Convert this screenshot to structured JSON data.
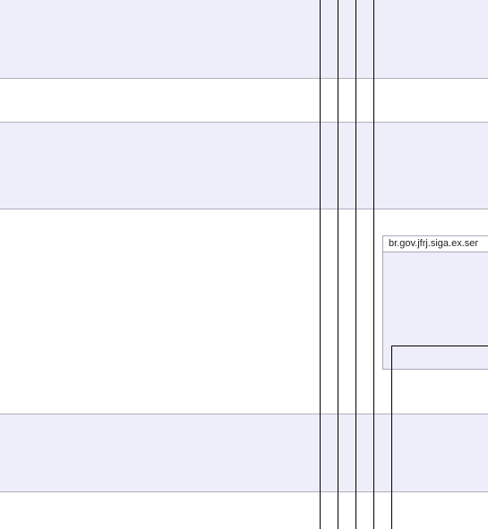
{
  "diagram": {
    "class_box": {
      "title": "br.gov.jfrj.siga.ex.ser"
    },
    "colors": {
      "band_fill": "#eeeefb",
      "band_border": "#b0b0bc",
      "line": "#000000",
      "background": "#ffffff"
    }
  }
}
